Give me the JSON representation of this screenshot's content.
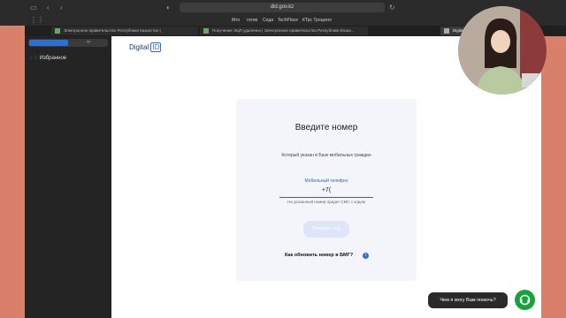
{
  "browser": {
    "url": "did.gov.kz",
    "bookmarks": [
      "Мто",
      "готов",
      "Седа",
      "TechPlace",
      "КТрс Троцкого"
    ],
    "tabs": [
      {
        "label": "Электронное правительство Республики Казахстан |"
      },
      {
        "label": "Получение ЭЦП удаленно | Электронное правительство Республики Казах..."
      },
      {
        "label": "Digital"
      }
    ]
  },
  "sidebar": {
    "favorites_label": "Избранное"
  },
  "page": {
    "logo_text": "Digital",
    "logo_id": "ID",
    "card": {
      "title": "Введите номер",
      "hint": "Который указан в Базе мобильных граждан",
      "field_label": "Мобильный телефон",
      "field_value": "+7(",
      "field_help": "На указанный номер придет СМС с кодом",
      "get_code_button": "Получить код",
      "update_link": "Как обновить номер в БМГ?",
      "info_icon": "i"
    }
  },
  "chat": {
    "prompt": "Чем я могу Вам помочь?"
  },
  "colors": {
    "accent": "#2f6fd1",
    "chat_green": "#18a33a",
    "background_orange": "#d9806a"
  }
}
